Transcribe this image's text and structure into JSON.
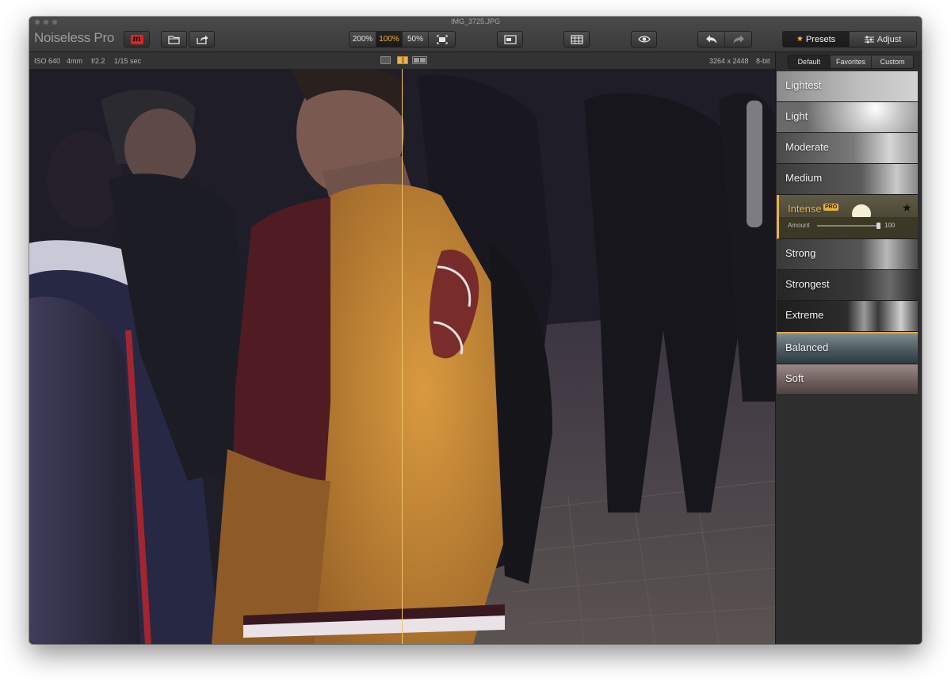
{
  "window": {
    "title": "IMG_3725.JPG"
  },
  "app": {
    "name": "Noiseless Pro"
  },
  "toolbar": {
    "zoom_options": [
      "200%",
      "100%",
      "50%"
    ],
    "zoom_active": "100%",
    "presets_tab": "Presets",
    "adjust_tab": "Adjust",
    "icons": {
      "brand": "macphun-logo-icon",
      "open": "folder-icon",
      "share": "share-icon",
      "fit": "fit-to-screen-icon",
      "compare": "compare-view-icon",
      "browser": "filmstrip-icon",
      "preview": "eye-icon",
      "undo": "undo-icon",
      "redo": "redo-icon"
    }
  },
  "info": {
    "iso": "ISO 640",
    "focal": "4mm",
    "aperture": "f/2.2",
    "shutter": "1/15 sec",
    "dimensions": "3264 x 2448",
    "bitdepth": "8-bit"
  },
  "sidebar": {
    "subtabs": [
      "Default",
      "Favorites",
      "Custom"
    ],
    "active_subtab": "Default",
    "presets": [
      {
        "label": "Lightest"
      },
      {
        "label": "Light"
      },
      {
        "label": "Moderate"
      },
      {
        "label": "Medium"
      },
      {
        "label": "Intense",
        "badge": "PRO",
        "selected": true,
        "amount_label": "Amount",
        "amount_value": "100",
        "amount_fraction": 1.0
      },
      {
        "label": "Strong"
      },
      {
        "label": "Strongest"
      },
      {
        "label": "Extreme"
      },
      {
        "label": "Balanced"
      },
      {
        "label": "Soft"
      }
    ]
  },
  "colors": {
    "accent": "#efb547",
    "divider": "#f2c46a"
  }
}
